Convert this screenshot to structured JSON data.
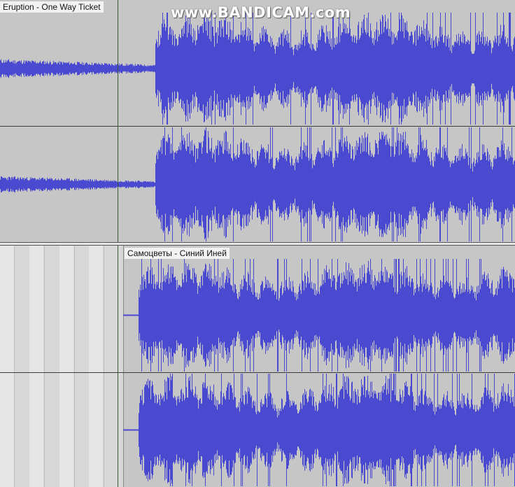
{
  "watermark": "www.BANDICAM.com",
  "tracks": [
    {
      "clip_name": "Eruption - One Way Ticket"
    },
    {
      "clip_name": "Самоцветы - Синий Иней"
    }
  ],
  "colors": {
    "waveform": "#4a4ad0",
    "clip_background": "#c6c6c6",
    "label_background": "#f2f2f2"
  }
}
